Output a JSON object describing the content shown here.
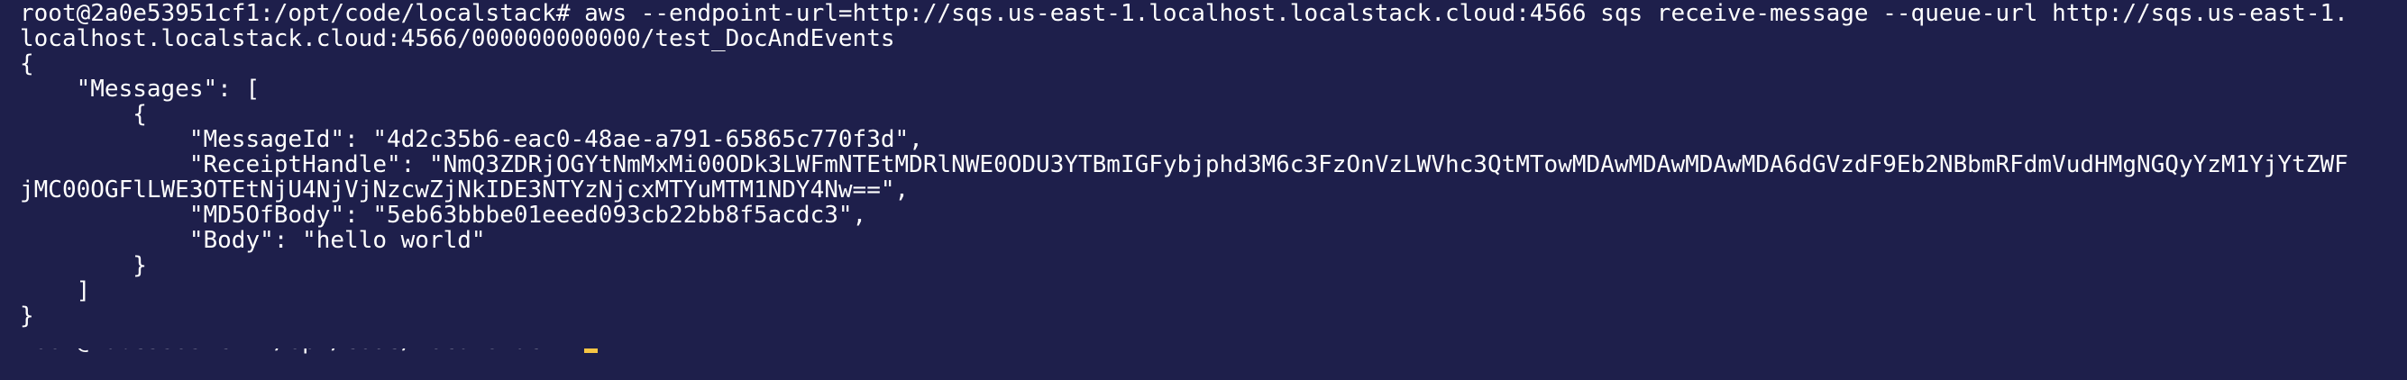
{
  "terminal": {
    "command_line_1": "root@2a0e53951cf1:/opt/code/localstack# aws --endpoint-url=http://sqs.us-east-1.localhost.localstack.cloud:4566 sqs receive-message --queue-url http://sqs.us-east-1.",
    "command_line_2": "localhost.localstack.cloud:4566/000000000000/test_DocAndEvents",
    "output": {
      "open_brace": "{",
      "messages_key_line": "    \"Messages\": [",
      "item_open": "        {",
      "message_id_line": "            \"MessageId\": \"4d2c35b6-eac0-48ae-a791-65865c770f3d\",",
      "receipt_handle_line_1": "            \"ReceiptHandle\": \"NmQ3ZDRjOGYtNmMxMi00ODk3LWFmNTEtMDRlNWE0ODU3YTBmIGFybjphd3M6c3FzOnVzLWVhc3QtMTowMDAwMDAwMDAwMDA6dGVzdF9Eb2NBbmRFdmVudHMgNGQyYzM1YjYtZWF",
      "receipt_handle_line_2": "jMC00OGFlLWE3OTEtNjU4NjVjNzcwZjNkIDE3NTYzNjcxMTYuMTM1NDY4Nw==\",",
      "md5_line": "            \"MD5OfBody\": \"5eb63bbbe01eeed093cb22bb8f5acdc3\",",
      "body_line": "            \"Body\": \"hello world\"",
      "item_close": "        }",
      "array_close": "    ]",
      "close_brace": "}"
    },
    "prompt": "root@2a0e53951cf1:/opt/code/localstack# ",
    "colors": {
      "background": "#1e1f4b",
      "text": "#ffffff",
      "cursor": "#f6c544"
    }
  }
}
